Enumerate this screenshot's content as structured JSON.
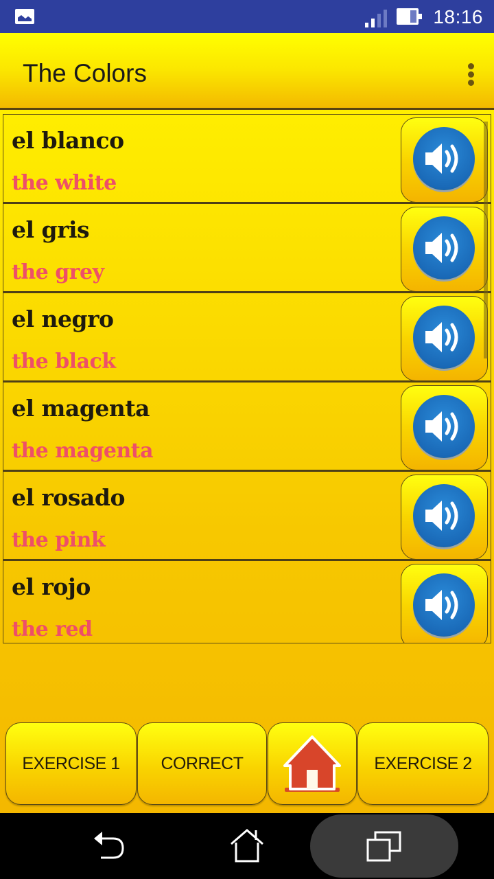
{
  "status_bar": {
    "notification_icon": "gallery-icon",
    "signal_icon": "signal-icon",
    "battery_icon": "battery-icon",
    "time": "18:16"
  },
  "app_bar": {
    "title": "The Colors",
    "menu_icon": "overflow-menu-icon"
  },
  "list": {
    "scroll_position": 0,
    "items": [
      {
        "word": "el blanco",
        "translation": "the white",
        "audio_icon": "speaker-icon"
      },
      {
        "word": "el gris",
        "translation": "the grey",
        "audio_icon": "speaker-icon"
      },
      {
        "word": "el negro",
        "translation": "the black",
        "audio_icon": "speaker-icon"
      },
      {
        "word": "el magenta",
        "translation": "the magenta",
        "audio_icon": "speaker-icon"
      },
      {
        "word": "el rosado",
        "translation": "the pink",
        "audio_icon": "speaker-icon"
      },
      {
        "word": "el rojo",
        "translation": "the red",
        "audio_icon": "speaker-icon"
      }
    ]
  },
  "bottom_buttons": {
    "exercise1": "EXERCISE 1",
    "correct": "CORRECT",
    "home_icon": "house-icon",
    "exercise2": "EXERCISE 2"
  },
  "nav_bar": {
    "back_icon": "back-icon",
    "home_icon": "home-icon",
    "recents_icon": "recents-icon"
  },
  "colors": {
    "status_bar": "#2e3f9e",
    "app_yellow": "#ffee00",
    "translation_pink": "#ee4f68",
    "speaker_blue": "#1a6ab8",
    "house_red": "#d8452a"
  }
}
